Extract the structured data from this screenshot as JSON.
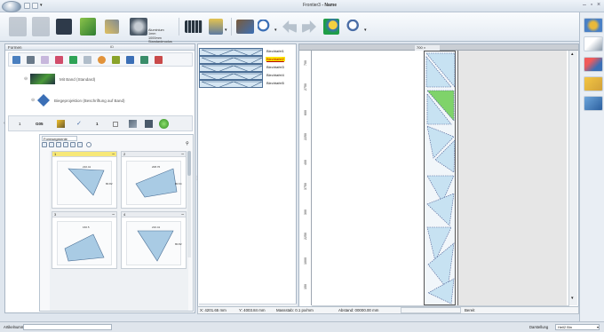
{
  "window": {
    "title": "Frontier3",
    "title_suffix": " - Name"
  },
  "ribbon": {
    "material_lines": [
      "Aluminium",
      "1mm",
      "1000mm",
      "Standardmodus"
    ],
    "colors": {
      "blue": "#2f6db5",
      "green": "#3f9a2e",
      "yellow": "#e7c21a",
      "gray": "#7a8794"
    }
  },
  "left_panel": {
    "title": "Formen",
    "tab2": "ID",
    "tree": {
      "row1_label": "Mit Band (Standard)",
      "row2_label": "Biegeprojektion (Beschriftung auf Band)",
      "row3": {
        "index": "1",
        "code": "G05",
        "qty": "1"
      }
    },
    "shapes_tab": "Formsegmente",
    "cards": [
      {
        "title": "1",
        "dim_top": "210.41",
        "dim_side": "80.82",
        "fill": "#a9cbe4"
      },
      {
        "title": "2",
        "dim_top": "208.76",
        "dim_side": "80.64",
        "fill": "#a9cbe4"
      },
      {
        "title": "3",
        "dim_top": "160.5",
        "dim_side": "",
        "fill": "#a9cbe4"
      },
      {
        "title": "4",
        "dim_top": "210.41",
        "dim_side": "80.82",
        "fill": "#a9cbe4"
      }
    ]
  },
  "sheets": {
    "items": [
      {
        "label": "Blechtafel1",
        "active": false
      },
      {
        "label": "Blechtafel2",
        "active": true
      },
      {
        "label": "Blechtafel3",
        "active": false
      },
      {
        "label": "Blechtafel4",
        "active": false
      },
      {
        "label": "Blechtafel5",
        "active": false
      }
    ]
  },
  "canvas": {
    "tab": "700",
    "ruler_labels": [
      "700",
      "2750",
      "600",
      "2250",
      "400",
      "3750",
      "300",
      "2250",
      "1000",
      "150"
    ],
    "highlight_color": "#7fd36a",
    "part_color": "#c7e2f2"
  },
  "status": {
    "x": "X: 4201.65 mm",
    "y": "Y: 4003.84 mm",
    "scale": "Massstab: 0.1 px/mm",
    "distance": "Abstand: 00000.00 mm",
    "ready": "Bereit"
  },
  "bottom": {
    "filter_label": "Artikelnummer-Filter",
    "view_label": "Darstellung",
    "view_value": "Hell2 Bin"
  }
}
